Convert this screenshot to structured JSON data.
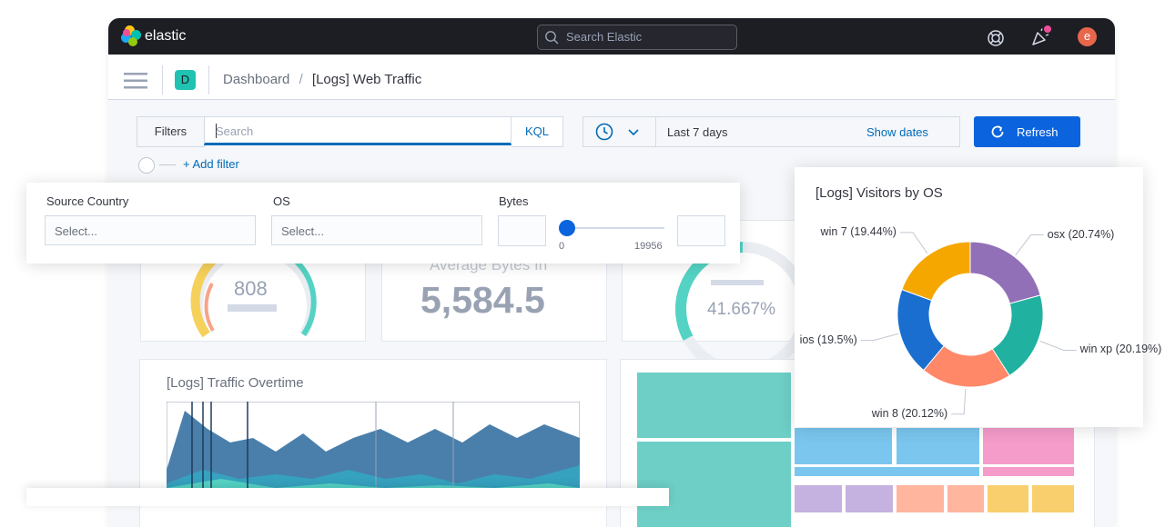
{
  "topbar": {
    "brand": "elastic",
    "search_placeholder": "Search Elastic",
    "avatar_initial": "e"
  },
  "header": {
    "space_initial": "D",
    "breadcrumb_root": "Dashboard",
    "breadcrumb_sep": "/",
    "breadcrumb_current": "[Logs] Web Traffic"
  },
  "query_bar": {
    "filters_label": "Filters",
    "search_placeholder": "Search",
    "language_label": "KQL",
    "time_range": "Last 7 days",
    "show_dates_label": "Show dates",
    "refresh_label": "Refresh",
    "add_filter_label": "+ Add filter"
  },
  "controls": {
    "source_country": {
      "label": "Source Country",
      "placeholder": "Select..."
    },
    "os": {
      "label": "OS",
      "placeholder": "Select..."
    },
    "bytes": {
      "label": "Bytes",
      "min": "0",
      "max": "19956"
    }
  },
  "panels": {
    "gauge_value": "808",
    "average_bytes_label": "Average Bytes In",
    "average_bytes_value": "5,584.5",
    "percent_value": "41.667%",
    "traffic_title": "[Logs] Traffic Overtime"
  },
  "colors": {
    "topbar": "#1d1e24",
    "primary_button": "#0b64dd",
    "link": "#006bb8",
    "space_badge": "#20c3b1",
    "avatar": "#e7664c"
  },
  "chart_data": {
    "type": "pie",
    "title": "[Logs] Visitors by OS",
    "categories": [
      "osx",
      "win xp",
      "win 8",
      "ios",
      "win 7"
    ],
    "values": [
      20.74,
      20.19,
      20.12,
      19.5,
      19.44
    ],
    "labels": [
      "osx (20.74%)",
      "win xp (20.19%)",
      "win 8 (20.12%)",
      "ios (19.5%)",
      "win 7 (19.44%)"
    ],
    "colors": [
      "#9170b8",
      "#20b1a1",
      "#ff8868",
      "#1a6ed0",
      "#f5a700"
    ]
  }
}
